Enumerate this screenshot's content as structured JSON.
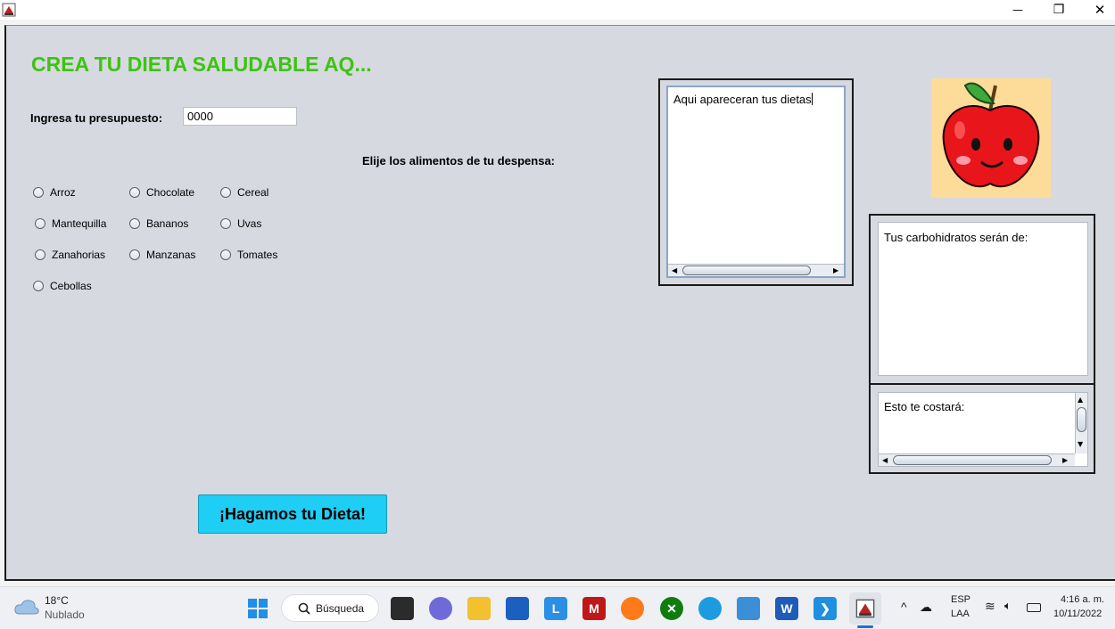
{
  "window": {
    "title": "",
    "minimize_glyph": "—",
    "maximize_glyph": "❐",
    "close_glyph": "✕"
  },
  "app": {
    "title": "CREA TU DIETA SALUDABLE AQ...",
    "budget_label": "Ingresa tu presupuesto:",
    "budget_value": "0000",
    "foods_label": "Elije los alimentos de tu despensa:",
    "foods": [
      {
        "label": "Arroz",
        "checked": false
      },
      {
        "label": "Chocolate",
        "checked": false
      },
      {
        "label": "Cereal",
        "checked": false
      },
      {
        "label": "Mantequilla",
        "checked": false
      },
      {
        "label": "Bananos",
        "checked": false
      },
      {
        "label": "Uvas",
        "checked": false
      },
      {
        "label": "Zanahorias",
        "checked": false
      },
      {
        "label": "Manzanas",
        "checked": false
      },
      {
        "label": "Tomates",
        "checked": false
      },
      {
        "label": "Cebollas",
        "checked": false
      }
    ],
    "diets_text": "Aqui apareceran tus dietas",
    "carbs_text": "Tus carbohidratos serán de:",
    "cost_text": "Esto te costará:",
    "submit_label": "¡Hagamos tu Dieta!",
    "logo": "apple-mascot"
  },
  "taskbar": {
    "weather_temp": "18°C",
    "weather_desc": "Nublado",
    "search_label": "Búsqueda",
    "lang_top": "ESP",
    "lang_bottom": "LAA",
    "time": "4:16 a. m.",
    "date": "10/11/2022",
    "apps": [
      "start-icon",
      "search",
      "task-view-icon",
      "chat-icon",
      "file-explorer-icon",
      "store-icon",
      "l-app-icon",
      "mcafee-icon",
      "firefox-icon",
      "xbox-icon",
      "edge-icon",
      "notepad-icon",
      "word-icon",
      "vscode-icon",
      "java-icon"
    ]
  },
  "colors": {
    "title_green": "#3cc40f",
    "button_cyan": "#1ecef4",
    "panel_bg": "#d6d9e0"
  }
}
